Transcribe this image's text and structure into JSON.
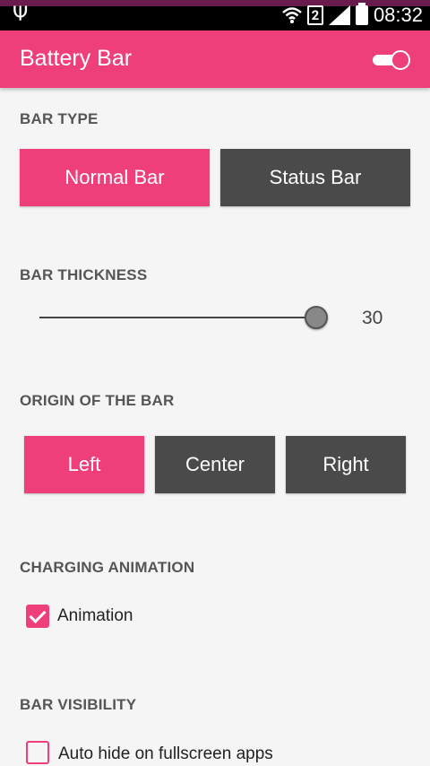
{
  "status_bar": {
    "usb_icon": "usb-icon",
    "wifi_icon": "wifi-icon",
    "sim_label": "2",
    "signal_icon": "signal-icon",
    "battery_icon": "battery-icon",
    "time": "08:32"
  },
  "app_bar": {
    "title": "Battery Bar",
    "toggle_on": true,
    "color": "#ef3f7b"
  },
  "bar_type": {
    "title": "BAR TYPE",
    "options": [
      "Normal Bar",
      "Status Bar"
    ],
    "selected": "Normal Bar"
  },
  "bar_thickness": {
    "title": "BAR THICKNESS",
    "value": "30"
  },
  "origin": {
    "title": "ORIGIN OF THE BAR",
    "options": [
      "Left",
      "Center",
      "Right"
    ],
    "selected": "Left"
  },
  "charging_animation": {
    "title": "CHARGING ANIMATION",
    "checkbox_label": "Animation",
    "checked": true
  },
  "bar_visibility": {
    "title": "BAR VISIBILITY",
    "checkbox_label": "Auto hide on fullscreen apps",
    "checked": false
  },
  "colors": {
    "accent": "#ef3f7b",
    "inactive_button": "#4a4a4a"
  }
}
